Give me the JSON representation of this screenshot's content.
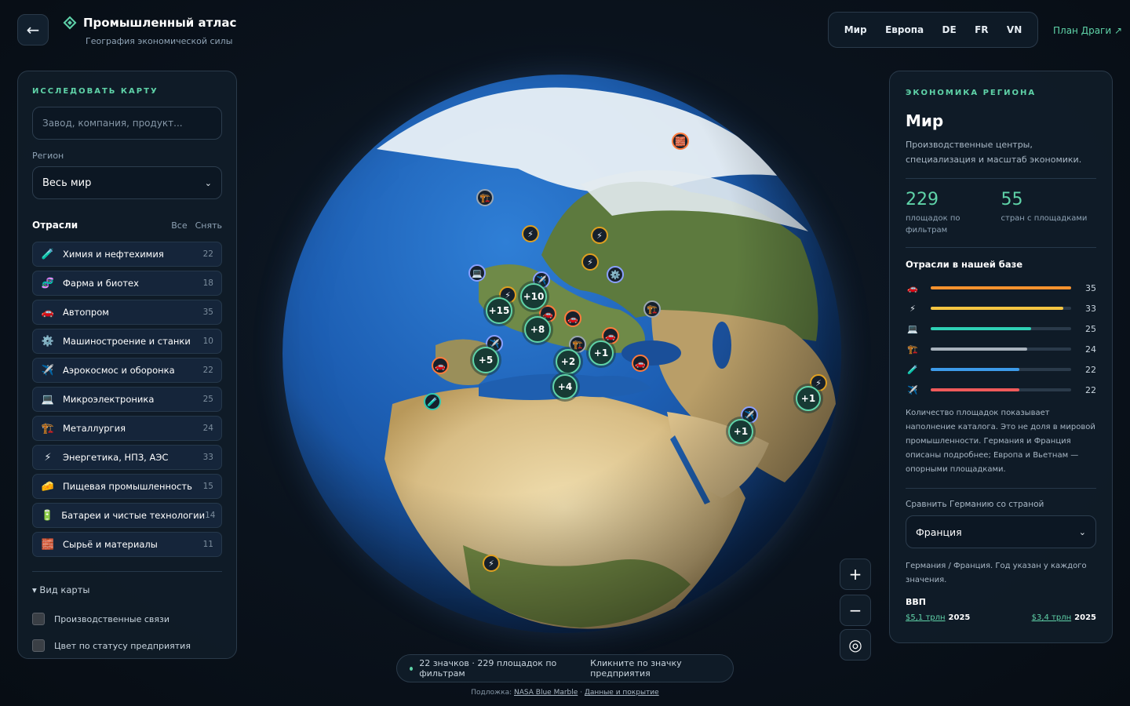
{
  "header": {
    "back_icon": "←",
    "title": "Промышленный атлас",
    "subtitle": "География экономической силы",
    "tabs": [
      "Мир",
      "Европа",
      "DE",
      "FR",
      "VN"
    ],
    "link": "План Драги ↗"
  },
  "left": {
    "kicker": "ИССЛЕДОВАТЬ КАРТУ",
    "search_placeholder": "Завод, компания, продукт...",
    "region_label": "Регион",
    "region_value": "Весь мир",
    "industries_title": "Отрасли",
    "all_label": "Все",
    "clear_label": "Снять",
    "industries": [
      {
        "icon": "🧪",
        "label": "Химия и нефтехимия",
        "count": "22"
      },
      {
        "icon": "🧬",
        "label": "Фарма и биотех",
        "count": "18"
      },
      {
        "icon": "🚗",
        "label": "Автопром",
        "count": "35"
      },
      {
        "icon": "⚙️",
        "label": "Машиностроение и станки",
        "count": "10"
      },
      {
        "icon": "✈️",
        "label": "Аэрокосмос и оборонка",
        "count": "22"
      },
      {
        "icon": "💻",
        "label": "Микроэлектроника",
        "count": "25"
      },
      {
        "icon": "🏗️",
        "label": "Металлургия",
        "count": "24"
      },
      {
        "icon": "⚡",
        "label": "Энергетика, НПЗ, АЭС",
        "count": "33"
      },
      {
        "icon": "🧀",
        "label": "Пищевая промышленность",
        "count": "15"
      },
      {
        "icon": "🔋",
        "label": "Батареи и чистые технологии",
        "count": "14"
      },
      {
        "icon": "🧱",
        "label": "Сырьё и материалы",
        "count": "11"
      }
    ],
    "map_view_label": "▾ Вид карты",
    "checkbox_links": "Производственные связи",
    "checkbox_status": "Цвет по статусу предприятия"
  },
  "globe": {
    "clusters": [
      "+15",
      "+10",
      "+8",
      "+5",
      "+2",
      "+1",
      "+4",
      "+1",
      "+1"
    ],
    "markers": [
      "⚡",
      "⚡",
      "⚡",
      "⚡",
      "⚡",
      "⚡",
      "⚡",
      "💻",
      "✈️",
      "✈️",
      "✈️",
      "🏗️",
      "🏗️",
      "🏗️",
      "🚗",
      "🚗",
      "🚗",
      "🚗",
      "🚗",
      "⚙️",
      "🧪",
      "🧱"
    ]
  },
  "zoom": {
    "in": "+",
    "out": "−",
    "reset": "◎"
  },
  "status": {
    "summary": "22 значков · 229 площадок по фильтрам",
    "hint": "Кликните по значку предприятия"
  },
  "credits": {
    "prefix": "Подложка: ",
    "source": "NASA Blue Marble",
    "sep": " · ",
    "coverage": "Данные и покрытие"
  },
  "right": {
    "kicker": "ЭКОНОМИКА РЕГИОНА",
    "title": "Мир",
    "description": "Производственные центры, специализация и масштаб экономики.",
    "stat1_value": "229",
    "stat1_label": "площадок по фильтрам",
    "stat2_value": "55",
    "stat2_label": "стран с площадками",
    "bars_title": "Отрасли в нашей базе",
    "bars": [
      {
        "icon": "🚗",
        "value": 35,
        "color": "#f5922e"
      },
      {
        "icon": "⚡",
        "value": 33,
        "color": "#f5c542"
      },
      {
        "icon": "💻",
        "value": 25,
        "color": "#2fd0b5"
      },
      {
        "icon": "🏗️",
        "value": 24,
        "color": "#a8b2bc"
      },
      {
        "icon": "🧪",
        "value": 22,
        "color": "#3d9be9"
      },
      {
        "icon": "✈️",
        "value": 22,
        "color": "#ef5a5a"
      }
    ],
    "note": "Количество площадок показывает наполнение каталога. Это не доля в мировой промышленности. Германия и Франция описаны подробнее; Европа и Вьетнам — опорными площадками.",
    "compare_label": "Сравнить Германию со страной",
    "compare_value": "Франция",
    "compare_note": "Германия / Франция. Год указан у каждого значения.",
    "gdp_label": "ВВП",
    "gdp_left": "$5,1 трлн",
    "gdp_left_year": "2025",
    "gdp_right": "$3,4 трлн",
    "gdp_right_year": "2025"
  }
}
